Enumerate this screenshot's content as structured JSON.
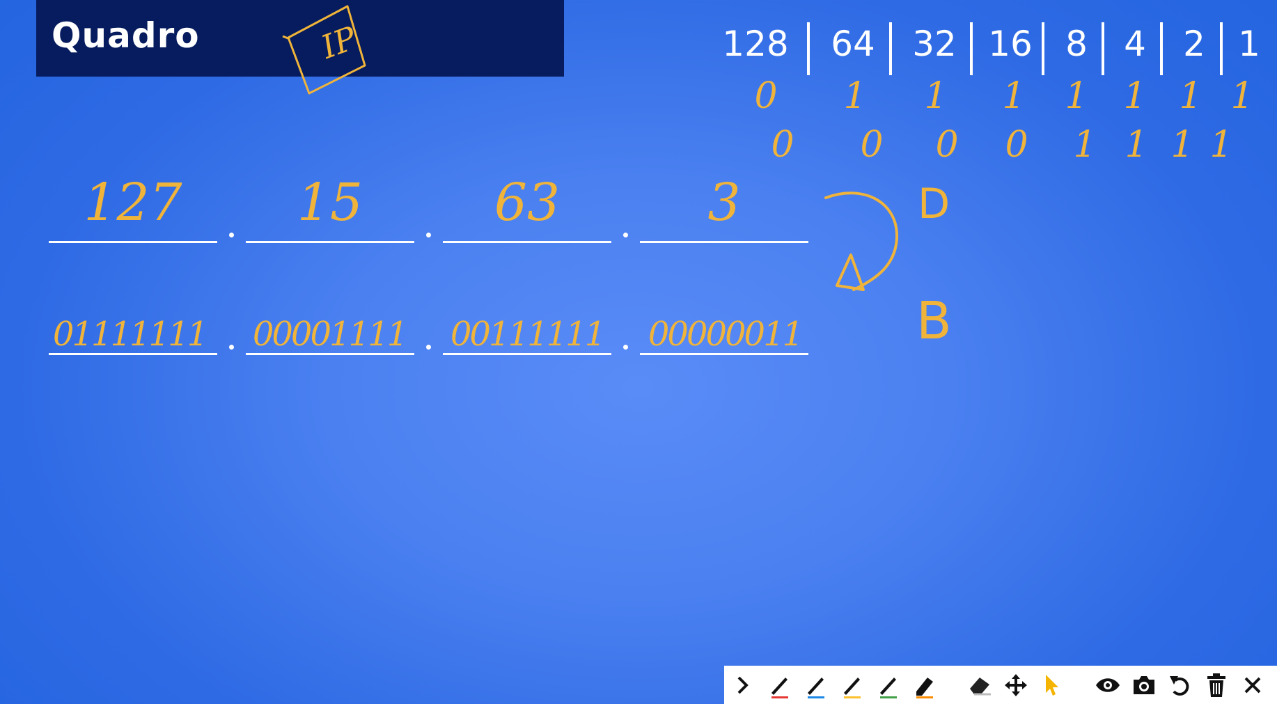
{
  "header": {
    "title": "Quadro",
    "ip_note": "IP"
  },
  "bit_table": {
    "headers": [
      "128",
      "64",
      "32",
      "16",
      "8",
      "4",
      "2",
      "1"
    ],
    "rows": [
      [
        "0",
        "1",
        "1",
        "1",
        "1",
        "1",
        "1",
        "1"
      ],
      [
        "0",
        "0",
        "0",
        "0",
        "1",
        "1",
        "1",
        "1"
      ]
    ]
  },
  "address": {
    "decimal": [
      "127",
      "15",
      "63",
      "3"
    ],
    "binary": [
      "01111111",
      "00001111",
      "00111111",
      "00000011"
    ]
  },
  "labels": {
    "decimal_letter": "D",
    "binary_letter": "B"
  },
  "toolbar": {
    "items": [
      {
        "name": "expand-chevron-icon"
      },
      {
        "name": "pen-red-icon",
        "color": "#e53935"
      },
      {
        "name": "pen-blue-icon",
        "color": "#1e88e5"
      },
      {
        "name": "pen-yellow-icon",
        "color": "#fbc02d"
      },
      {
        "name": "pen-green-icon",
        "color": "#43a047"
      },
      {
        "name": "highlighter-orange-icon",
        "color": "#fb8c00"
      },
      {
        "name": "eraser-icon"
      },
      {
        "name": "move-icon"
      },
      {
        "name": "pointer-icon",
        "color": "#f4b400"
      },
      {
        "name": "eye-icon"
      },
      {
        "name": "camera-icon"
      },
      {
        "name": "undo-icon"
      },
      {
        "name": "trash-icon"
      },
      {
        "name": "close-icon"
      }
    ]
  },
  "colors": {
    "ink": "#f0b43a",
    "title_bg": "#061c5e"
  }
}
